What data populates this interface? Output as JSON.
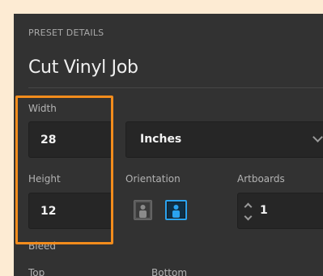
{
  "section_label": "PRESET DETAILS",
  "preset_name": "Cut Vinyl Job",
  "width": {
    "label": "Width",
    "value": "28"
  },
  "units": {
    "selected": "Inches"
  },
  "height": {
    "label": "Height",
    "value": "12"
  },
  "orientation": {
    "label": "Orientation",
    "selected": "landscape"
  },
  "artboards": {
    "label": "Artboards",
    "value": "1"
  },
  "bleed": {
    "label": "Bleed",
    "top_label": "Top",
    "bottom_label": "Bottom"
  },
  "colors": {
    "highlight": "#f28c1c",
    "accent": "#2aa3f0"
  }
}
